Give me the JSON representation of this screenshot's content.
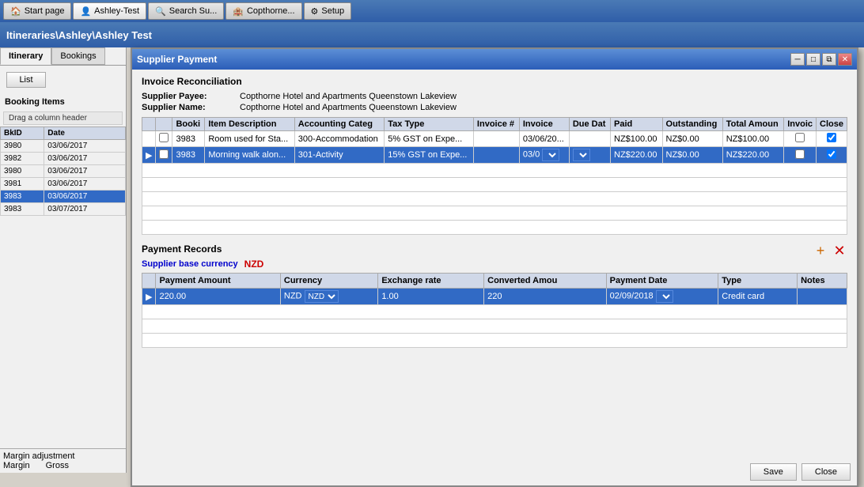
{
  "taskbar": {
    "buttons": [
      {
        "label": "Start page",
        "icon": "home-icon",
        "active": false
      },
      {
        "label": "Ashley-Test",
        "icon": "person-icon",
        "active": false
      },
      {
        "label": "Search Su...",
        "icon": "search-icon",
        "active": false
      },
      {
        "label": "Copthorne...",
        "icon": "building-icon",
        "active": false
      },
      {
        "label": "Setup",
        "icon": "gear-icon",
        "active": false
      }
    ]
  },
  "breadcrumb": {
    "text": "Itineraries\\Ashley\\Ashley Test"
  },
  "left_panel": {
    "tabs": [
      {
        "label": "Itinerary",
        "active": true
      },
      {
        "label": "Bookings",
        "active": false
      }
    ],
    "list_button": "List",
    "booking_items_label": "Booking Items",
    "drag_hint": "Drag a column header",
    "columns": [
      {
        "label": "BkID"
      },
      {
        "label": "Date"
      }
    ],
    "rows": [
      {
        "bkid": "3980",
        "date": "03/06/2017",
        "selected": false
      },
      {
        "bkid": "3982",
        "date": "03/06/2017",
        "selected": false
      },
      {
        "bkid": "3980",
        "date": "03/06/2017",
        "selected": false
      },
      {
        "bkid": "3981",
        "date": "03/06/2017",
        "selected": false
      },
      {
        "bkid": "3983",
        "date": "03/06/2017",
        "selected": true
      },
      {
        "bkid": "3983",
        "date": "03/07/2017",
        "selected": false
      }
    ]
  },
  "dialog": {
    "title": "Supplier Payment",
    "controls": [
      "minimize",
      "maximize",
      "close"
    ],
    "section_title": "Invoice Reconciliation",
    "supplier_payee_label": "Supplier Payee:",
    "supplier_payee_value": "Copthorne Hotel and Apartments Queenstown Lakeview",
    "supplier_name_label": "Supplier Name:",
    "supplier_name_value": "Copthorne Hotel and Apartments Queenstown Lakeview",
    "invoice_columns": [
      {
        "label": "",
        "key": "arrow"
      },
      {
        "label": "",
        "key": "checkbox"
      },
      {
        "label": "Booki",
        "key": "booki"
      },
      {
        "label": "Item Description",
        "key": "item_desc"
      },
      {
        "label": "Accounting Categ",
        "key": "acct_cat"
      },
      {
        "label": "Tax Type",
        "key": "tax_type"
      },
      {
        "label": "Invoice #",
        "key": "invoice_num"
      },
      {
        "label": "Invoice",
        "key": "invoice"
      },
      {
        "label": "Due Dat",
        "key": "due_date"
      },
      {
        "label": "Paid",
        "key": "paid"
      },
      {
        "label": "Outstanding",
        "key": "outstanding"
      },
      {
        "label": "Total Amoun",
        "key": "total_amount"
      },
      {
        "label": "Invoic",
        "key": "invoic"
      },
      {
        "label": "Close",
        "key": "close"
      }
    ],
    "invoice_rows": [
      {
        "arrow": "",
        "checkbox": false,
        "booki": "3983",
        "item_desc": "Room used for Sta...",
        "acct_cat": "300-Accommodation",
        "tax_type": "5% GST on Expe...",
        "invoice_num": "",
        "invoice": "03/06/20...",
        "due_date": "",
        "paid": "NZ$100.00",
        "outstanding": "NZ$0.00",
        "total_amount": "NZ$100.00",
        "invoic": false,
        "close": true,
        "selected": false
      },
      {
        "arrow": "▶",
        "checkbox": false,
        "booki": "3983",
        "item_desc": "Morning walk alon...",
        "acct_cat": "301-Activity",
        "tax_type": "15% GST on Expe...",
        "invoice_num": "",
        "invoice": "03/0",
        "due_date": "",
        "paid": "NZ$220.00",
        "outstanding": "NZ$0.00",
        "total_amount": "NZ$220.00",
        "invoic": false,
        "close": true,
        "selected": true
      }
    ],
    "payment_section": {
      "title": "Payment Records",
      "base_currency_label": "Supplier base currency",
      "base_currency_value": "NZD",
      "add_icon": "+",
      "delete_icon": "×",
      "payment_columns": [
        {
          "label": "",
          "key": "arrow"
        },
        {
          "label": "Payment Amount",
          "key": "payment_amount"
        },
        {
          "label": "Currency",
          "key": "currency"
        },
        {
          "label": "Exchange rate",
          "key": "exchange_rate"
        },
        {
          "label": "Converted Amou",
          "key": "converted_amount"
        },
        {
          "label": "Payment Date",
          "key": "payment_date"
        },
        {
          "label": "Type",
          "key": "type"
        },
        {
          "label": "Notes",
          "key": "notes"
        }
      ],
      "payment_rows": [
        {
          "arrow": "▶",
          "payment_amount": "220.00",
          "currency": "NZD",
          "exchange_rate": "1.00",
          "converted_amount": "220",
          "payment_date": "02/09/2018",
          "type": "Credit card",
          "notes": "",
          "selected": true
        }
      ]
    },
    "bottom_buttons": [
      "Save",
      "Close"
    ]
  },
  "margin_adjustment": {
    "label": "Margin adjustment",
    "margin_col": "Margin",
    "gross_col": "Gross"
  }
}
